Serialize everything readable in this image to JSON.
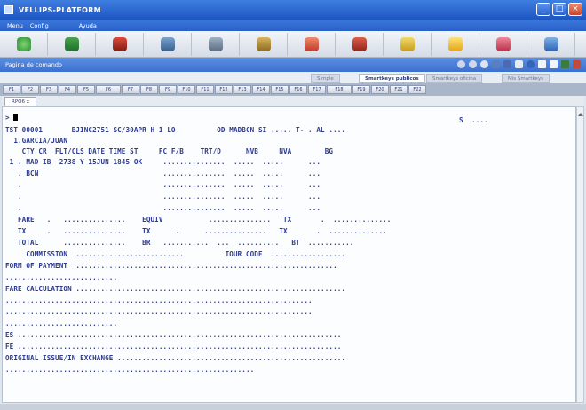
{
  "window": {
    "title": "VELLIPS-PLATFORM"
  },
  "menu": {
    "items": [
      "Menu",
      "Config",
      "Ayuda"
    ]
  },
  "command_bar": {
    "label": "Pagina de comando"
  },
  "tabs": [
    "Simple",
    "Smartkeys publicos",
    "Smartkeys oficina",
    "Mis Smartkeys"
  ],
  "fkeys": [
    "F1",
    "F2",
    "F3",
    "F4",
    "F5",
    "F6",
    "F7",
    "F8",
    "F9",
    "F10",
    "F11",
    "F12",
    "F13",
    "F14",
    "F15",
    "F16",
    "F17",
    "F18",
    "F19",
    "F20",
    "F21",
    "F22"
  ],
  "panel_tab": "RPO6 x",
  "terminal": {
    "lines": [
      ">",
      "TST 00001       BJINC2751 SC/30APR H 1 LO          OD MADBCN SI ..... T- . AL ....",
      "  1.GARCIA/JUAN",
      "    CTY CR  FLT/CLS DATE TIME ST     FC F/B    TRT/D      NVB     NVA        BG",
      " 1 . MAD IB  2738 Y 15JUN 1845 OK     ...............  .....  .....      ...",
      "   . BCN                              ...............  .....  .....      ...",
      "   .                                  ...............  .....  .....      ...",
      "   .                                  ...............  .....  .....      ...",
      "   .                                  ...............  .....  .....      ...",
      "   FARE   .   ...............    EQUIV           ...............   TX       .  ..............",
      "   TX     .   ...............    TX      .      ...............   TX       .  ..............",
      "   TOTAL      ...............    BR   ...........  ...  ..........   BT  ...........",
      "     COMMISSION  ..........................          TOUR CODE  ..................",
      "FORM OF PAYMENT  ...............................................................",
      "...........................",
      "FARE CALCULATION .................................................................",
      "..........................................................................",
      "..........................................................................",
      "...........................",
      "ES ..............................................................................",
      "FE ..............................................................................",
      "ORIGINAL ISSUE/IN EXCHANGE .......................................................",
      "............................................................"
    ],
    "right_marker": "S  ....",
    "cursor_char": ""
  }
}
